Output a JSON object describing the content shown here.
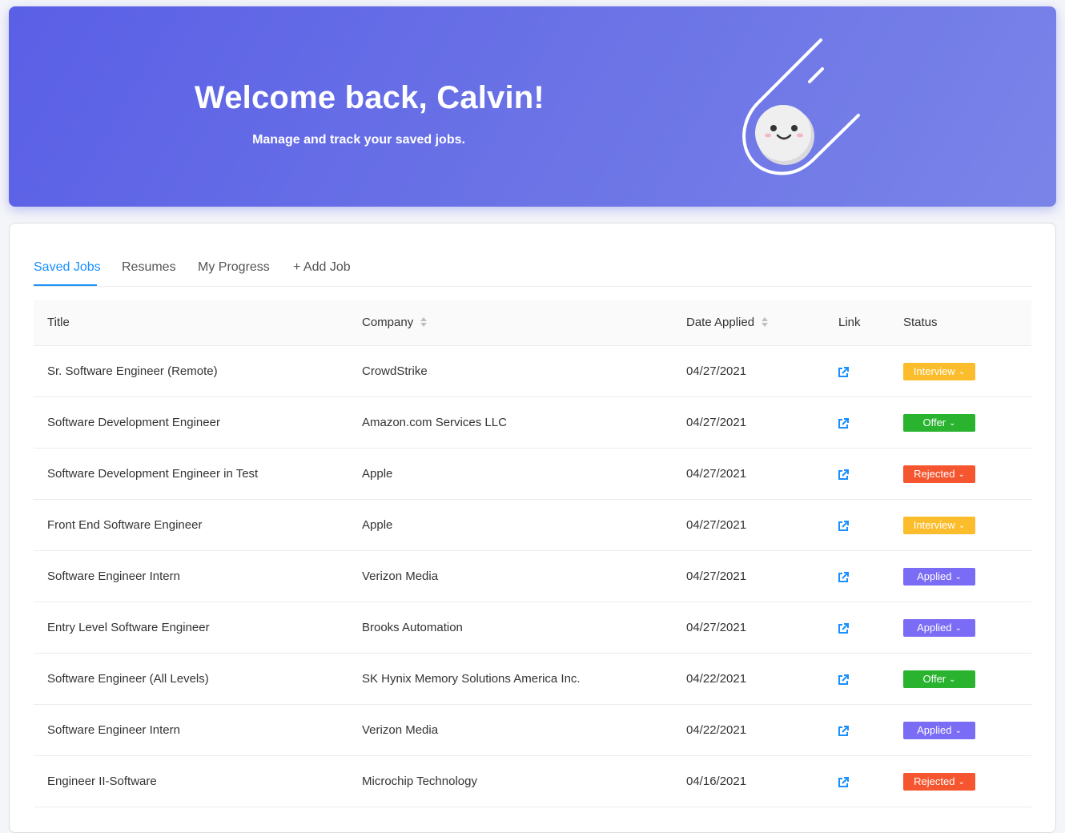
{
  "header": {
    "title": "Welcome back, Calvin!",
    "subtitle": "Manage and track your saved jobs.",
    "mascot_icon": "comet-smiley-icon"
  },
  "tabs": [
    {
      "label": "Saved Jobs",
      "active": true
    },
    {
      "label": "Resumes",
      "active": false
    },
    {
      "label": "My Progress",
      "active": false
    },
    {
      "label": "+ Add Job",
      "active": false
    }
  ],
  "table": {
    "columns": [
      "Title",
      "Company",
      "Date Applied",
      "Link",
      "Status"
    ],
    "sortable": [
      "Company",
      "Date Applied"
    ],
    "rows": [
      {
        "title": "Sr. Software Engineer (Remote)",
        "company": "CrowdStrike",
        "date": "04/27/2021",
        "status": "Interview"
      },
      {
        "title": "Software Development Engineer",
        "company": "Amazon.com Services LLC",
        "date": "04/27/2021",
        "status": "Offer"
      },
      {
        "title": "Software Development Engineer in Test",
        "company": "Apple",
        "date": "04/27/2021",
        "status": "Rejected"
      },
      {
        "title": "Front End Software Engineer",
        "company": "Apple",
        "date": "04/27/2021",
        "status": "Interview"
      },
      {
        "title": "Software Engineer Intern",
        "company": "Verizon Media",
        "date": "04/27/2021",
        "status": "Applied"
      },
      {
        "title": "Entry Level Software Engineer",
        "company": "Brooks Automation",
        "date": "04/27/2021",
        "status": "Applied"
      },
      {
        "title": "Software Engineer (All Levels)",
        "company": "SK Hynix Memory Solutions America Inc.",
        "date": "04/22/2021",
        "status": "Offer"
      },
      {
        "title": "Software Engineer Intern",
        "company": "Verizon Media",
        "date": "04/22/2021",
        "status": "Applied"
      },
      {
        "title": "Engineer II-Software",
        "company": "Microchip Technology",
        "date": "04/16/2021",
        "status": "Rejected"
      }
    ]
  },
  "status_colors": {
    "Interview": "#fbbd2c",
    "Offer": "#29b32f",
    "Rejected": "#f5562f",
    "Applied": "#7b6cf5"
  },
  "link_icon": "external-link-icon",
  "link_color": "#1890ff",
  "hero_gradient": [
    "#5a5fe6",
    "#7a84e8"
  ]
}
